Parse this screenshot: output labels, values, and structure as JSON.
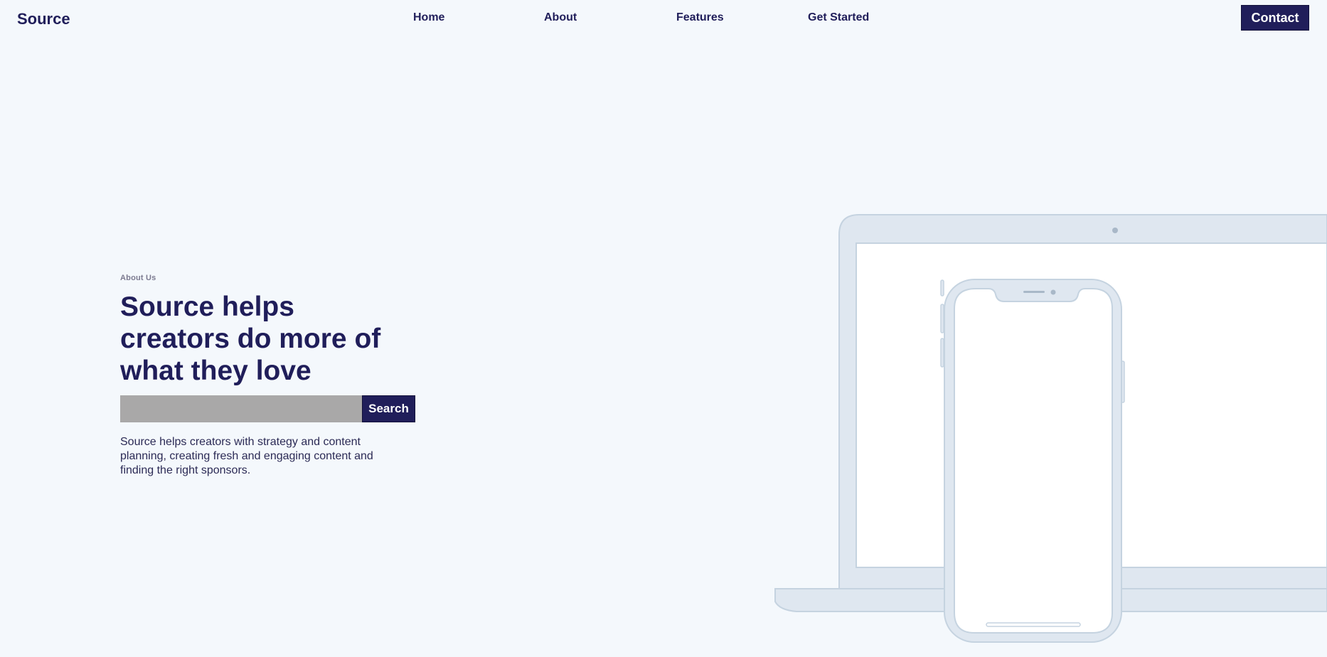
{
  "nav": {
    "logo": "Source",
    "links": [
      {
        "label": "Home"
      },
      {
        "label": "About"
      },
      {
        "label": "Features"
      },
      {
        "label": "Get Started"
      }
    ],
    "contact_label": "Contact"
  },
  "hero": {
    "eyebrow": "About Us",
    "headline": "Source helps creators do more of what they love",
    "search": {
      "placeholder": "",
      "value": "",
      "button_label": "Search"
    },
    "description": "Source helps creators with strategy and content planning, creating fresh and engaging content and finding the right sponsors."
  },
  "colors": {
    "background": "#f4f8fc",
    "brand": "#201e5a",
    "input_gray": "#a9a8a8",
    "device_frame": "#dfe7f0",
    "device_stroke": "#c5d3e0"
  },
  "icons": {
    "illustration": "laptop-and-phone-illustration"
  }
}
